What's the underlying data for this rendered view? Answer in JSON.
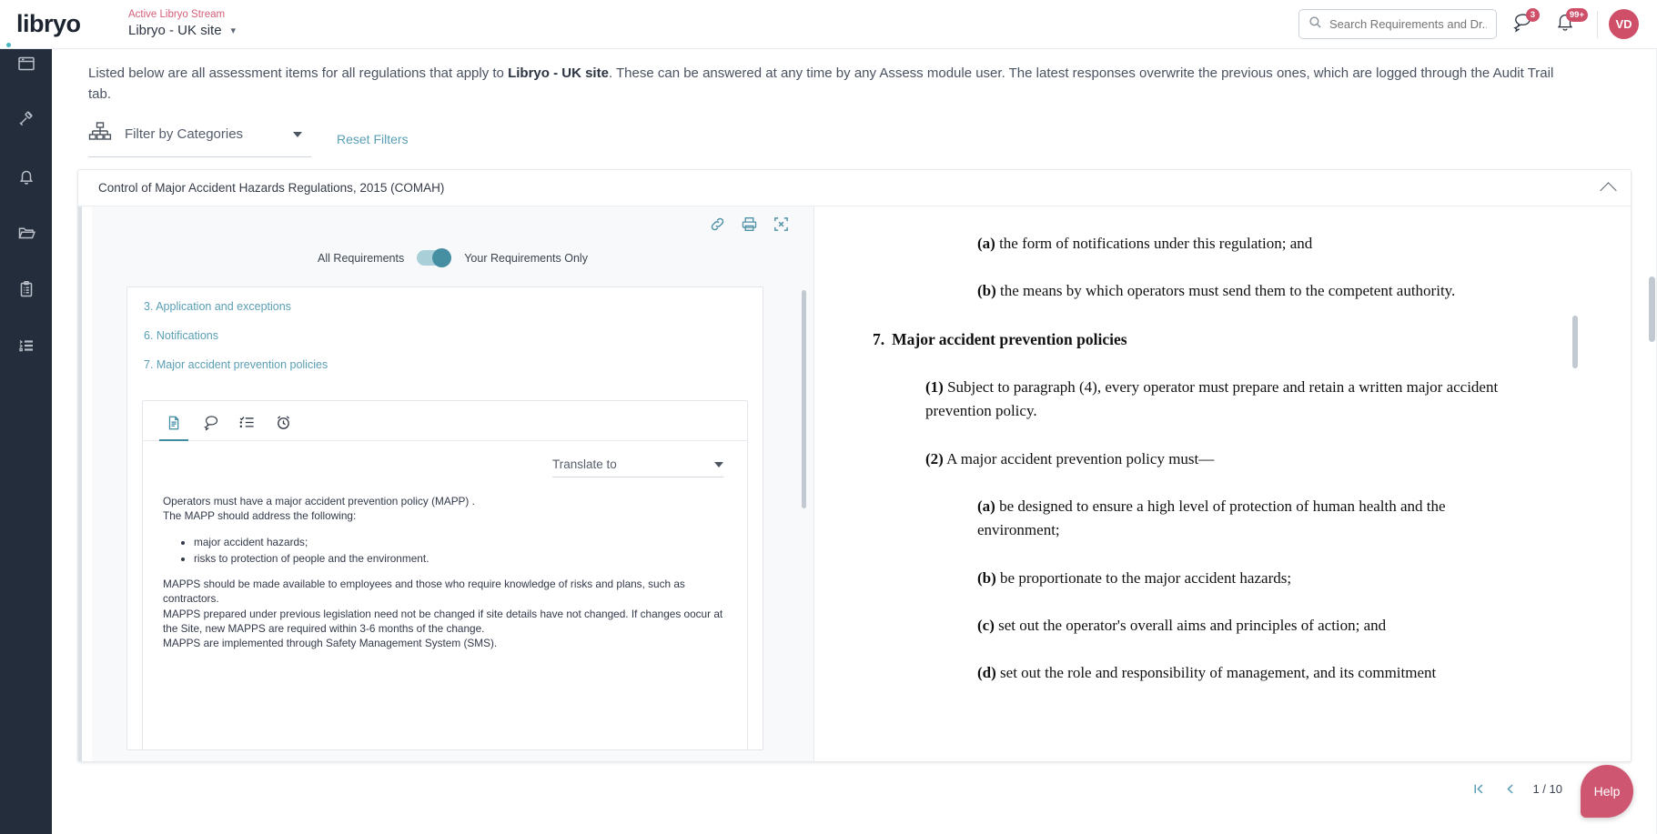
{
  "topbar": {
    "logo": "libryo",
    "stream_label": "Active Libryo Stream",
    "stream_name": "Libryo - UK site",
    "search_placeholder": "Search Requirements and Dr...",
    "messages_badge": "3",
    "notifications_badge": "99+",
    "avatar_initials": "VD"
  },
  "sidebar": {
    "items": [
      {
        "name": "dashboard",
        "icon": "window-icon"
      },
      {
        "name": "legal",
        "icon": "gavel-icon"
      },
      {
        "name": "alerts",
        "icon": "bell-icon"
      },
      {
        "name": "library",
        "icon": "folder-icon"
      },
      {
        "name": "assess",
        "icon": "clipboard-icon"
      },
      {
        "name": "tasks",
        "icon": "list-filter-icon"
      }
    ]
  },
  "intro": {
    "part1": "Listed below are all assessment items for all regulations that apply to ",
    "stream": "Libryo - UK site",
    "part2": ". These can be answered at any time by any Assess module user. The latest responses overwrite the previous ones, which are logged through the Audit Trail tab."
  },
  "filters": {
    "categories_label": "Filter by Categories",
    "reset_label": "Reset Filters"
  },
  "regulation": {
    "title": "Control of Major Accident Hazards Regulations, 2015 (COMAH)",
    "toolbar": {
      "link": "link-icon",
      "print": "print-icon",
      "expand": "fullscreen-icon"
    },
    "toggle": {
      "left_label": "All Requirements",
      "right_label": "Your Requirements Only",
      "state": "right"
    },
    "section_links": [
      "3. Application and exceptions",
      "6. Notifications",
      "7. Major accident prevention policies"
    ],
    "item_tabs": [
      {
        "name": "document",
        "icon": "document-icon",
        "active": true
      },
      {
        "name": "comments",
        "icon": "comments-icon",
        "active": false
      },
      {
        "name": "checklist",
        "icon": "checklist-icon",
        "active": false
      },
      {
        "name": "reminders",
        "icon": "alarm-clock-icon",
        "active": false
      }
    ],
    "translate": {
      "label": "Translate to"
    },
    "item_body": {
      "line1": "Operators must have a major accident prevention policy (MAPP) .",
      "line2": "The MAPP should address the following:",
      "bullets": [
        "major accident hazards;",
        "risks to protection of people and the environment."
      ],
      "line3": "MAPPS should be made available to employees and those who require knowledge of risks and plans, such as contractors.",
      "line4": "MAPPS prepared under previous legislation need not be changed if site details have not changed. If changes oocur at the Site, new MAPPS are required within 3-6 months of the change.",
      "line5": "MAPPS are implemented through Safety Management System (SMS)."
    }
  },
  "document": {
    "blocks": [
      {
        "type": "indent2",
        "lead": "(a)",
        "text": " the form of notifications under this regulation; and"
      },
      {
        "type": "indent2",
        "lead": "(b)",
        "text": " the means by which operators must send them to the competent authority."
      },
      {
        "type": "heading",
        "num": "7.",
        "text": "Major accident prevention policies"
      },
      {
        "type": "indent1",
        "lead": "(1)",
        "text": " Subject to paragraph (4), every operator must prepare and retain a written major accident prevention policy."
      },
      {
        "type": "indent1",
        "lead": "(2)",
        "text": " A major accident prevention policy must—"
      },
      {
        "type": "indent2",
        "lead": "(a)",
        "text": " be designed to ensure a high level of protection of human health and the environment;"
      },
      {
        "type": "indent2",
        "lead": "(b)",
        "text": " be proportionate to the major accident hazards;"
      },
      {
        "type": "indent2",
        "lead": "(c)",
        "text": " set out the operator's overall aims and principles of action; and"
      },
      {
        "type": "indent2",
        "lead": "(d)",
        "text": " set out the role and responsibility of management, and its commitment"
      }
    ]
  },
  "pagination": {
    "first": "first-page",
    "prev": "previous-page",
    "count": "1 / 10",
    "next": "next-page",
    "last": "last-page"
  },
  "help": {
    "label": "Help"
  }
}
